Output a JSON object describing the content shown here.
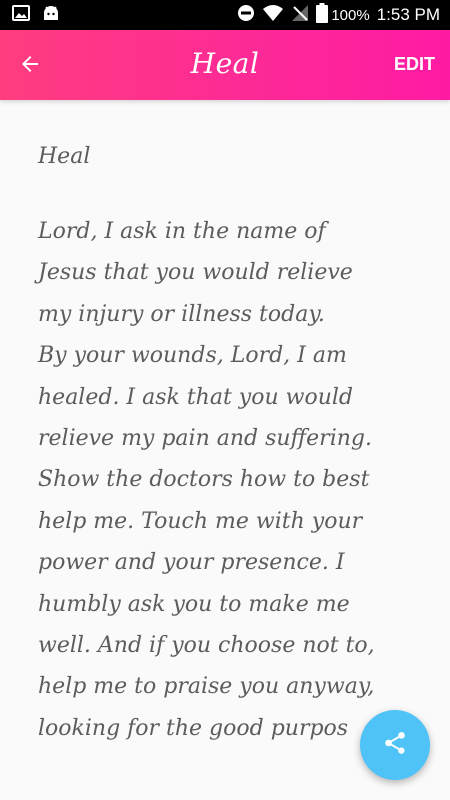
{
  "status_bar": {
    "battery": "100%",
    "time": "1:53 PM",
    "icons": [
      "image-icon",
      "android-icon",
      "do-not-disturb-icon",
      "wifi-icon",
      "no-sim-icon",
      "battery-icon"
    ]
  },
  "app_bar": {
    "title": "Heal",
    "back_icon": "arrow-left-icon",
    "edit_label": "EDIT",
    "gradient_colors": [
      "#ff3d7f",
      "#ff1aa3"
    ]
  },
  "prayer": {
    "title": "Heal",
    "body": "Lord, I ask in the name of\nJesus that you would relieve\nmy injury or illness today.\nBy your wounds, Lord, I am\nhealed. I ask that you would\nrelieve my pain and suffering.\nShow the doctors how to best\nhelp me. Touch me with your\npower and your presence. I\nhumbly ask you to make me\nwell. And if you choose not to,\nhelp me to praise you anyway,\nlooking for the good purpos"
  },
  "fab": {
    "icon": "share-icon",
    "color": "#4fc3f7"
  }
}
